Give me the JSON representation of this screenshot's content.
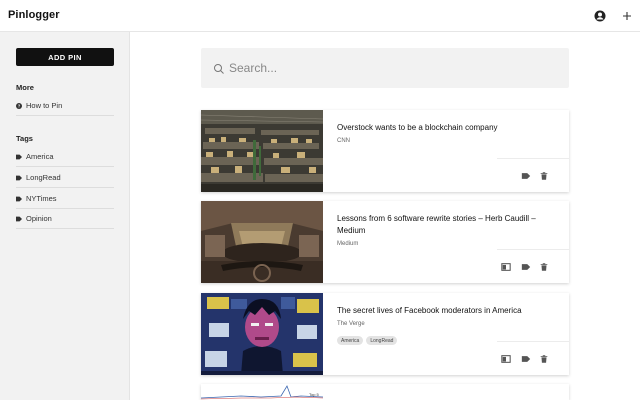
{
  "app": {
    "title": "Pinlogger"
  },
  "header": {
    "profile_icon": "account-circle-icon",
    "add_icon": "plus-icon"
  },
  "sidebar": {
    "add_pin_label": "ADD PIN",
    "more_title": "More",
    "more_items": [
      {
        "label": "How to Pin",
        "icon": "help-circle-icon"
      }
    ],
    "tags_title": "Tags",
    "tags": [
      {
        "label": "America",
        "icon": "tag-icon"
      },
      {
        "label": "LongRead",
        "icon": "tag-icon"
      },
      {
        "label": "NYTimes",
        "icon": "tag-icon"
      },
      {
        "label": "Opinion",
        "icon": "tag-icon"
      }
    ]
  },
  "search": {
    "placeholder": "Search...",
    "value": ""
  },
  "pins": [
    {
      "title": "Overstock wants to be a blockchain company",
      "source": "CNN",
      "tags": [],
      "thumbnail": "warehouse-shelves-photo",
      "actions": [
        "tag",
        "delete"
      ]
    },
    {
      "title": "Lessons from 6 software rewrite stories – Herb Caudill – Medium",
      "source": "Medium",
      "tags": [],
      "thumbnail": "rusty-car-interior-photo",
      "actions": [
        "reader",
        "tag",
        "delete"
      ]
    },
    {
      "title": "The secret lives of Facebook moderators in America",
      "source": "The Verge",
      "tags": [
        "America",
        "LongRead"
      ],
      "thumbnail": "moderator-illustration",
      "actions": [
        "reader",
        "tag",
        "delete"
      ]
    }
  ],
  "partial_pin": {
    "chart_label": "Top 5"
  },
  "colors": {
    "button_bg": "#111111",
    "sidebar_bg": "#f2f2f2",
    "search_bg": "#f2f2f2",
    "tag_bg": "#e3e3e3",
    "icon": "#555555"
  }
}
